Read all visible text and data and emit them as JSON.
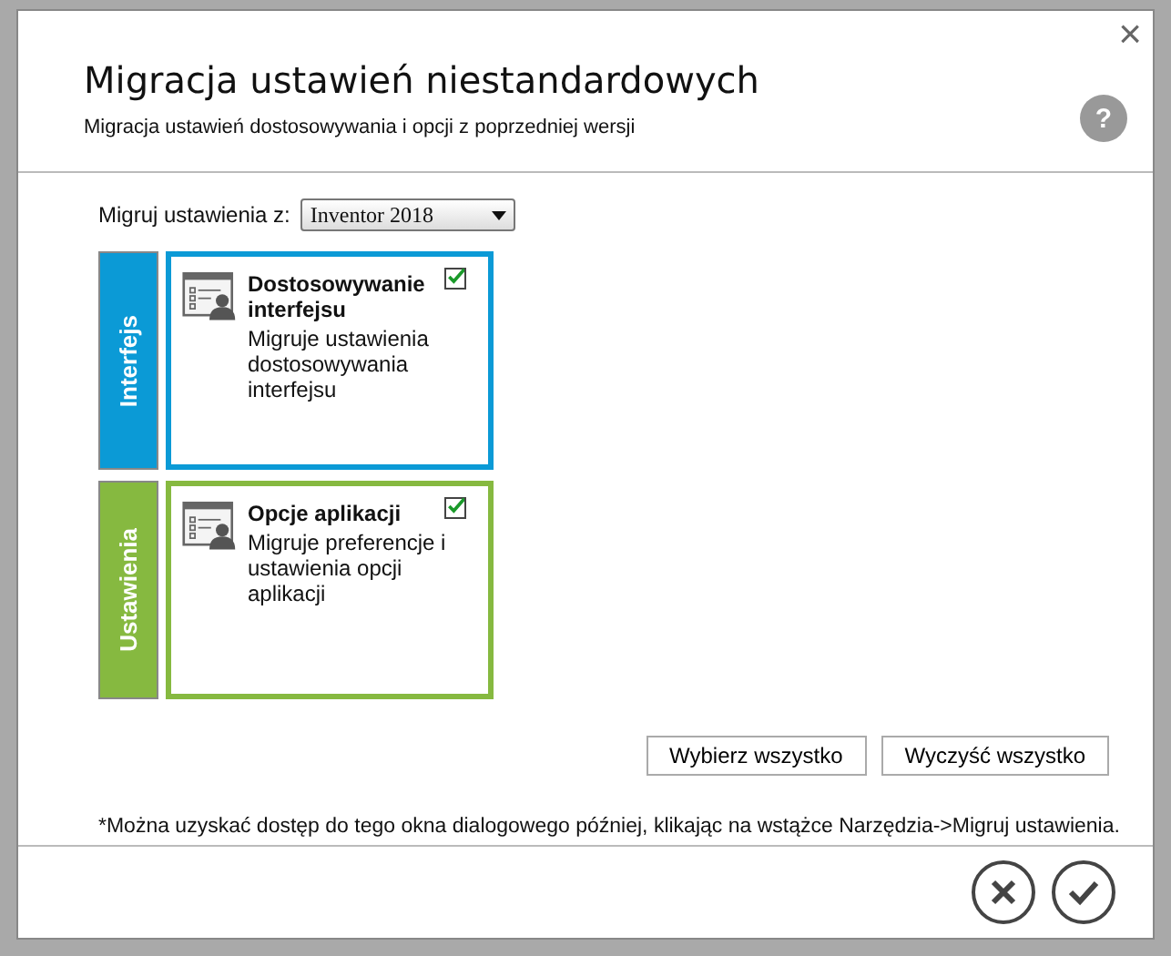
{
  "dialog": {
    "title": "Migracja ustawień niestandardowych",
    "subtitle": "Migracja ustawień dostosowywania i opcji z poprzedniej wersji",
    "help": "?",
    "close": "×"
  },
  "source": {
    "label": "Migruj ustawienia z:",
    "value": "Inventor 2018"
  },
  "groups": [
    {
      "label": "Interfejs",
      "color": "#0b9ad6",
      "card": {
        "title": "Dostosowywanie interfejsu",
        "description": "Migruje ustawienia dostosowywania interfejsu",
        "checked": true
      }
    },
    {
      "label": "Ustawienia",
      "color": "#86b940",
      "card": {
        "title": "Opcje aplikacji",
        "description": "Migruje preferencje i ustawienia opcji aplikacji",
        "checked": true
      }
    }
  ],
  "actions": [
    "Wybierz wszystko",
    "Wyczyść wszystko"
  ],
  "note": "*Można uzyskać dostęp do tego okna dialogowego później, klikając na wstążce Narzędzia->Migruj ustawienia."
}
